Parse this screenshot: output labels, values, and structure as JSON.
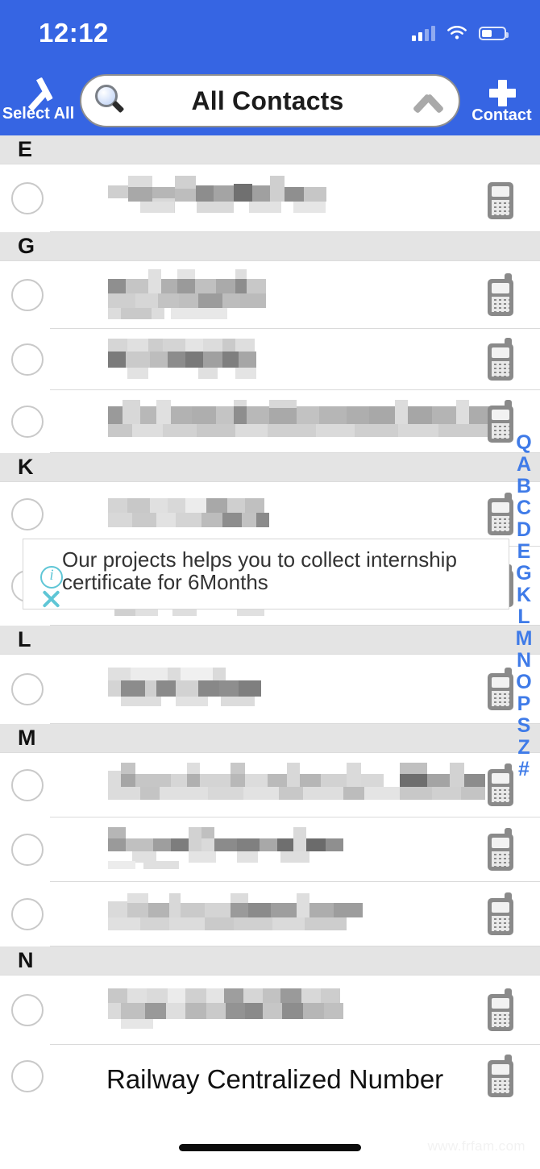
{
  "status_bar": {
    "time": "12:12",
    "signal_icon": "cellular-signal-icon",
    "wifi_icon": "wifi-icon",
    "battery_icon": "battery-icon",
    "battery_level_pct": 40,
    "signal_bars_filled": 2,
    "signal_bars_total": 4
  },
  "navbar": {
    "select_all_label": "Select All",
    "select_all_icon": "checkmark-icon",
    "add_contact_label": "Contact",
    "add_contact_icon": "plus-icon",
    "search": {
      "title": "All Contacts",
      "search_icon": "magnifier-icon",
      "collapse_icon": "chevron-up-icon"
    }
  },
  "banner": {
    "text": "Our projects helps you to collect internship\ncertificate for 6Months",
    "info_icon": "info-circle-icon",
    "close_icon": "close-x-icon",
    "accent_color": "#5FC6D6"
  },
  "colors": {
    "header_blue": "#3665E3",
    "section_gray": "#E4E4E4",
    "index_blue": "#3F7BE8",
    "separator": "#DADADA",
    "phone_icon_gray": "#8A8A8A"
  },
  "alpha_index": {
    "search_glyph": "Q",
    "letters": [
      "A",
      "B",
      "C",
      "D",
      "E",
      "G",
      "K",
      "L",
      "M",
      "N",
      "O",
      "P",
      "S",
      "Z",
      "#"
    ]
  },
  "watermark": "www.frfam.com",
  "list": {
    "checkbox_icon": "unchecked-circle-icon",
    "phone_icon": "mobile-phone-icon",
    "sections": [
      {
        "letter": "E",
        "contacts": [
          {
            "name": "",
            "redacted": true,
            "phone_icon": "pager-phone-icon"
          }
        ]
      },
      {
        "letter": "G",
        "contacts": [
          {
            "name": "",
            "redacted": true,
            "phone_icon": "mobile-phone-icon"
          },
          {
            "name": "",
            "redacted": true,
            "phone_icon": "mobile-phone-icon"
          },
          {
            "name": "",
            "redacted": true,
            "phone_icon": "mobile-phone-icon"
          }
        ]
      },
      {
        "letter": "K",
        "contacts": [
          {
            "name": "",
            "redacted": true,
            "phone_icon": "mobile-phone-icon"
          },
          {
            "name": "",
            "redacted": true,
            "phone_icon": "mobile-phone-icon"
          }
        ]
      },
      {
        "letter": "L",
        "contacts": [
          {
            "name": "",
            "redacted": true,
            "phone_icon": "mobile-phone-icon"
          }
        ]
      },
      {
        "letter": "M",
        "contacts": [
          {
            "name": "",
            "redacted": true,
            "phone_icon": "mobile-phone-icon"
          },
          {
            "name": "",
            "redacted": true,
            "phone_icon": "mobile-phone-icon"
          },
          {
            "name": "",
            "redacted": true,
            "phone_icon": "mobile-phone-icon"
          }
        ]
      },
      {
        "letter": "N",
        "contacts": [
          {
            "name": "",
            "redacted": true,
            "phone_icon": "mobile-phone-icon"
          },
          {
            "name": "Railway Centralized Number",
            "name_bold_part": "Number",
            "redacted": false,
            "phone_icon": "mobile-phone-icon"
          }
        ]
      }
    ]
  }
}
